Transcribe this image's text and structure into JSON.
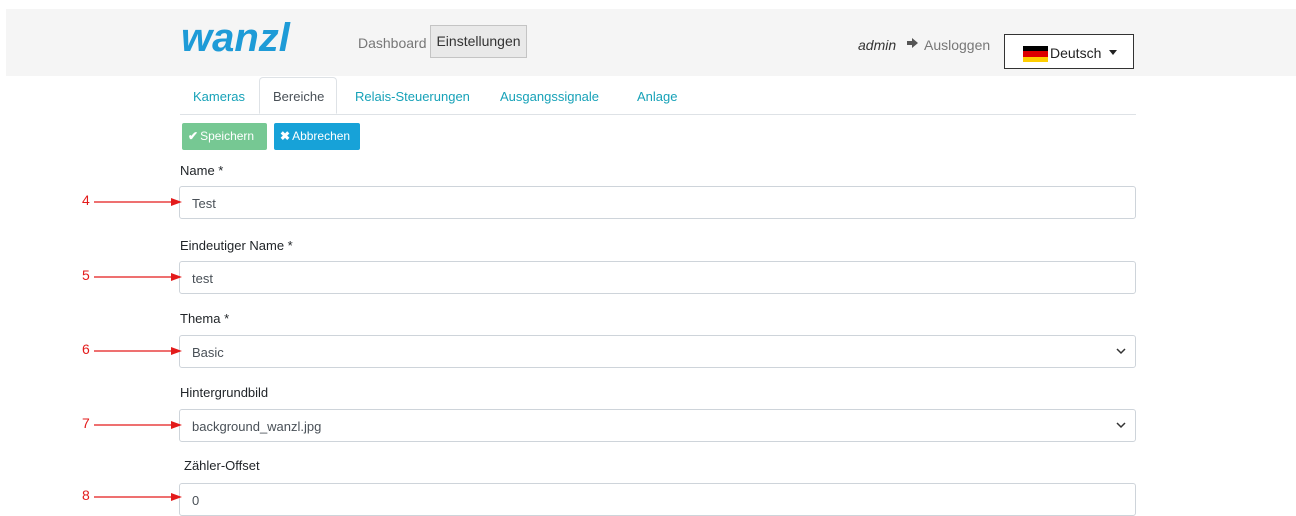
{
  "header": {
    "logo_text": "wanzl",
    "nav": {
      "dashboard": "Dashboard",
      "settings": "Einstellungen"
    },
    "user": "admin",
    "logout": "Ausloggen",
    "language": "Deutsch"
  },
  "tabs": [
    {
      "label": "Kameras"
    },
    {
      "label": "Bereiche"
    },
    {
      "label": "Relais-Steuerungen"
    },
    {
      "label": "Ausgangssignale"
    },
    {
      "label": "Anlage"
    }
  ],
  "actions": {
    "save": "Speichern",
    "cancel": "Abbrechen"
  },
  "form": {
    "name": {
      "label": "Name *",
      "value": "Test"
    },
    "unique_name": {
      "label": "Eindeutiger Name *",
      "value": "test"
    },
    "theme": {
      "label": "Thema *",
      "value": "Basic"
    },
    "background": {
      "label": "Hintergrundbild",
      "value": "background_wanzl.jpg"
    },
    "counter_offset": {
      "label": "Zähler-Offset",
      "value": "0"
    }
  },
  "annotations": [
    "4",
    "5",
    "6",
    "7",
    "8"
  ],
  "colors": {
    "brand": "#1e9bd7",
    "tab_link": "#17a2b8",
    "save": "#76c893",
    "cancel": "#17a2d8",
    "annotation": "#e31b1b"
  }
}
